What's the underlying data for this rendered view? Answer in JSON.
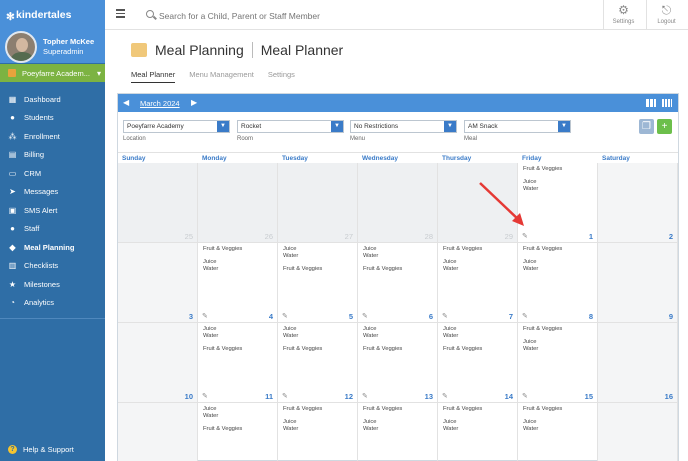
{
  "brand": "kindertales",
  "user": {
    "name": "Topher McKee",
    "role": "Superadmin"
  },
  "school": "Poeyfarre Academ...",
  "nav": [
    {
      "label": "Dashboard",
      "icon": "dashboard-icon",
      "glyph": "▦"
    },
    {
      "label": "Students",
      "icon": "students-icon",
      "glyph": "●"
    },
    {
      "label": "Enrollment",
      "icon": "enrollment-icon",
      "glyph": "⁂"
    },
    {
      "label": "Billing",
      "icon": "billing-icon",
      "glyph": "▤"
    },
    {
      "label": "CRM",
      "icon": "crm-icon",
      "glyph": "▭"
    },
    {
      "label": "Messages",
      "icon": "messages-icon",
      "glyph": "➤"
    },
    {
      "label": "SMS Alert",
      "icon": "sms-icon",
      "glyph": "▣"
    },
    {
      "label": "Staff",
      "icon": "staff-icon",
      "glyph": "●"
    },
    {
      "label": "Meal Planning",
      "icon": "meal-icon",
      "glyph": "◆"
    },
    {
      "label": "Checklists",
      "icon": "checklist-icon",
      "glyph": "▥"
    },
    {
      "label": "Milestones",
      "icon": "milestones-icon",
      "glyph": "★"
    },
    {
      "label": "Analytics",
      "icon": "analytics-icon",
      "glyph": "◔"
    }
  ],
  "help": "Help & Support",
  "search": {
    "placeholder": "Search for a Child, Parent or Staff Member"
  },
  "topbar": {
    "settings": "Settings",
    "logout": "Logout"
  },
  "page": {
    "title": "Meal Planning",
    "subtitle": "Meal Planner"
  },
  "tabs": [
    "Meal Planner",
    "Menu Management",
    "Settings"
  ],
  "calendar": {
    "month": "March 2024",
    "filters": [
      {
        "value": "Poeyfarre Academy",
        "label": "Location"
      },
      {
        "value": "Rocket",
        "label": "Room"
      },
      {
        "value": "No Restrictions",
        "label": "Menu"
      },
      {
        "value": "AM Snack",
        "label": "Meal"
      }
    ],
    "days": [
      "Sunday",
      "Monday",
      "Tuesday",
      "Wednesday",
      "Thursday",
      "Friday",
      "Saturday"
    ],
    "weeks": [
      [
        {
          "d": "25",
          "blank": true
        },
        {
          "d": "26",
          "blank": true
        },
        {
          "d": "27",
          "blank": true
        },
        {
          "d": "28",
          "blank": true
        },
        {
          "d": "29",
          "blank": true
        },
        {
          "d": "1",
          "meals": [
            "Fruit & Veggies",
            "Juice\nWater"
          ],
          "edit": true
        },
        {
          "d": "2",
          "weekend": true
        }
      ],
      [
        {
          "d": "3",
          "weekend": true
        },
        {
          "d": "4",
          "meals": [
            "Fruit & Veggies",
            "Juice\nWater"
          ],
          "edit": true
        },
        {
          "d": "5",
          "meals": [
            "Juice\nWater",
            "Fruit & Veggies"
          ],
          "edit": true
        },
        {
          "d": "6",
          "meals": [
            "Juice\nWater",
            "Fruit & Veggies"
          ],
          "edit": true
        },
        {
          "d": "7",
          "meals": [
            "Fruit & Veggies",
            "Juice\nWater"
          ],
          "edit": true
        },
        {
          "d": "8",
          "meals": [
            "Fruit & Veggies",
            "Juice\nWater"
          ],
          "edit": true
        },
        {
          "d": "9",
          "weekend": true
        }
      ],
      [
        {
          "d": "10",
          "weekend": true
        },
        {
          "d": "11",
          "meals": [
            "Juice\nWater",
            "Fruit & Veggies"
          ],
          "edit": true
        },
        {
          "d": "12",
          "meals": [
            "Juice\nWater",
            "Fruit & Veggies"
          ],
          "edit": true
        },
        {
          "d": "13",
          "meals": [
            "Juice\nWater",
            "Fruit & Veggies"
          ],
          "edit": true
        },
        {
          "d": "14",
          "meals": [
            "Juice\nWater",
            "Fruit & Veggies"
          ],
          "edit": true
        },
        {
          "d": "15",
          "meals": [
            "Fruit & Veggies",
            "Juice\nWater"
          ],
          "edit": true
        },
        {
          "d": "16",
          "weekend": true
        }
      ],
      [
        {
          "d": "",
          "weekend": true
        },
        {
          "d": "",
          "meals": [
            "Juice\nWater",
            "Fruit & Veggies"
          ]
        },
        {
          "d": "",
          "meals": [
            "Fruit & Veggies",
            "Juice\nWater"
          ]
        },
        {
          "d": "",
          "meals": [
            "Fruit & Veggies",
            "Juice\nWater"
          ]
        },
        {
          "d": "",
          "meals": [
            "Fruit & Veggies",
            "Juice\nWater"
          ]
        },
        {
          "d": "",
          "meals": [
            "Fruit & Veggies",
            "Juice\nWater"
          ]
        },
        {
          "d": "",
          "weekend": true
        }
      ]
    ]
  }
}
